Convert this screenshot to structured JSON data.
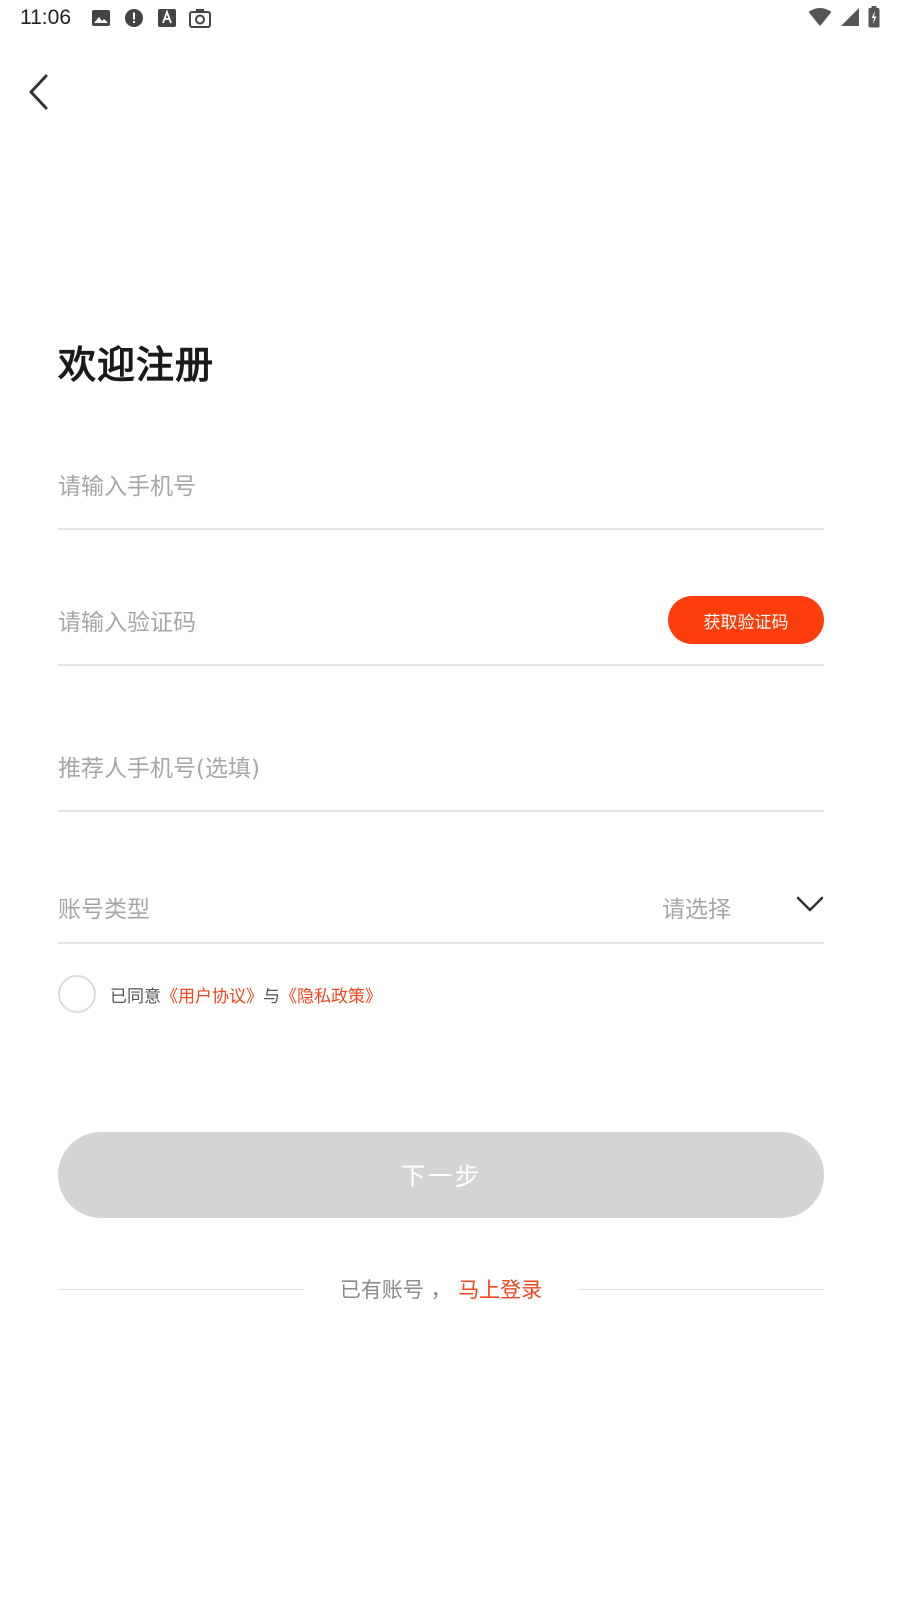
{
  "status_bar": {
    "time": "11:06",
    "left_icons": [
      "image-icon",
      "alert-icon",
      "font-icon",
      "camera-icon"
    ],
    "right_icons": [
      "wifi-icon",
      "signal-icon",
      "battery-icon"
    ]
  },
  "header": {
    "back_icon": "chevron-left-icon"
  },
  "page": {
    "title": "欢迎注册"
  },
  "form": {
    "phone": {
      "placeholder": "请输入手机号",
      "value": ""
    },
    "code": {
      "placeholder": "请输入验证码",
      "value": "",
      "get_code_label": "获取验证码"
    },
    "referrer": {
      "placeholder": "推荐人手机号(选填)",
      "value": ""
    },
    "account_type": {
      "label": "账号类型",
      "selected": "请选择"
    }
  },
  "agreement": {
    "prefix": "已同意",
    "user_agreement": "《用户协议》",
    "conjunction": "与",
    "privacy_policy": "《隐私政策》",
    "checked": false
  },
  "actions": {
    "next_label": "下一步"
  },
  "login_prompt": {
    "text": "已有账号 ，",
    "link": "马上登录"
  },
  "colors": {
    "accent": "#fe3d0c",
    "link": "#f0461e",
    "button_disabled": "#d4d4d4",
    "placeholder": "#a6a6a6",
    "divider": "#e2e2e2"
  }
}
